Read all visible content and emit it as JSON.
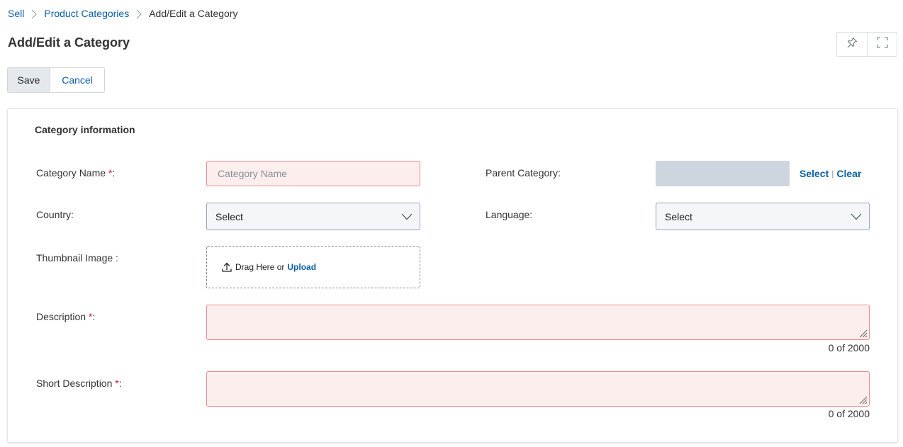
{
  "breadcrumb": {
    "items": [
      "Sell",
      "Product Categories"
    ],
    "current": "Add/Edit a Category"
  },
  "page": {
    "title": "Add/Edit a Category"
  },
  "header_actions": {
    "pin_icon": "pin-icon",
    "fullscreen_icon": "fullscreen-icon"
  },
  "toolbar": {
    "save_label": "Save",
    "cancel_label": "Cancel"
  },
  "form": {
    "section_title": "Category information",
    "required_marker": "*",
    "category_name": {
      "label": "Category Name ",
      "suffix": ":",
      "placeholder": "Category Name",
      "value": ""
    },
    "parent_category": {
      "label": "Parent Category:",
      "select_link": "Select",
      "separator": "|",
      "clear_link": "Clear"
    },
    "country": {
      "label": "Country:",
      "selected": "Select"
    },
    "language": {
      "label": "Language:",
      "selected": "Select"
    },
    "thumbnail": {
      "label": "Thumbnail Image :",
      "drag_text": "Drag Here or",
      "upload_link": "Upload",
      "icon": "upload-icon"
    },
    "description": {
      "label": "Description ",
      "suffix": ":",
      "counter": "0 of 2000"
    },
    "short_description": {
      "label": "Short Description ",
      "suffix": ":",
      "counter": "0 of 2000"
    }
  },
  "colors": {
    "link": "#0a5fa8",
    "required": "#c8102e",
    "invalid_bg": "#fdeeee",
    "invalid_border": "#e98a8a",
    "readonly_bg": "#cdd5df"
  }
}
